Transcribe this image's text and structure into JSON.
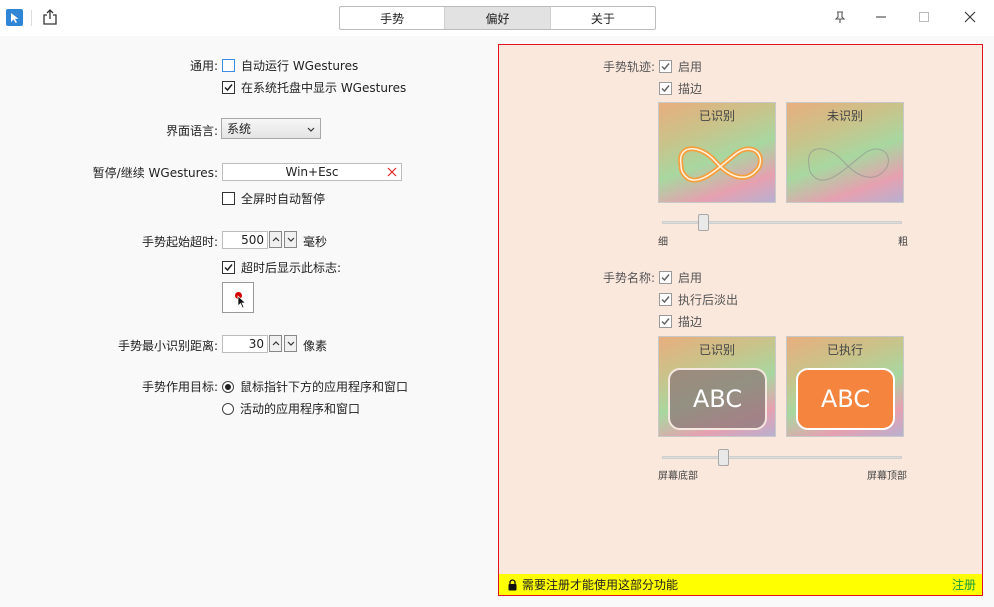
{
  "tabs": [
    {
      "label": "手势"
    },
    {
      "label": "偏好"
    },
    {
      "label": "关于"
    }
  ],
  "window_controls": {
    "pin": "pin-icon",
    "minimize": "minimize-icon",
    "maximize": "maximize-icon",
    "close": "close-icon"
  },
  "general": {
    "label": "通用:",
    "autorun": "自动运行 WGestures",
    "tray": "在系统托盘中显示 WGestures"
  },
  "language": {
    "label": "界面语言:",
    "value": "系统"
  },
  "pause": {
    "label": "暂停/继续 WGestures:",
    "hotkey": "Win+Esc",
    "fullscreen": "全屏时自动暂停"
  },
  "timeout": {
    "label": "手势起始超时:",
    "value": "500",
    "unit": "毫秒",
    "show_marker": "超时后显示此标志:"
  },
  "min_distance": {
    "label": "手势最小识别距离:",
    "value": "30",
    "unit": "像素"
  },
  "target": {
    "label": "手势作用目标:",
    "option1": "鼠标指针下方的应用程序和窗口",
    "option2": "活动的应用程序和窗口"
  },
  "trail": {
    "label": "手势轨迹:",
    "enable": "启用",
    "outline": "描边",
    "recognized": "已识别",
    "unrecognized": "未识别",
    "thin": "细",
    "thick": "粗",
    "width_level": 0.22
  },
  "name": {
    "label": "手势名称:",
    "enable": "启用",
    "fade": "执行后淡出",
    "outline": "描边",
    "recognized": "已识别",
    "executed": "已执行",
    "abc1": "ABC",
    "abc2": "ABC",
    "bottom": "屏幕底部",
    "top": "屏幕顶部",
    "position_level": 0.25
  },
  "notice": {
    "text": "需要注册才能使用这部分功能",
    "link": "注册"
  },
  "colors": {
    "accent_red": "#e0141e",
    "notice_bg": "#ffff00",
    "executed_orange": "#f5843f",
    "link_green": "#1a9a3a"
  }
}
